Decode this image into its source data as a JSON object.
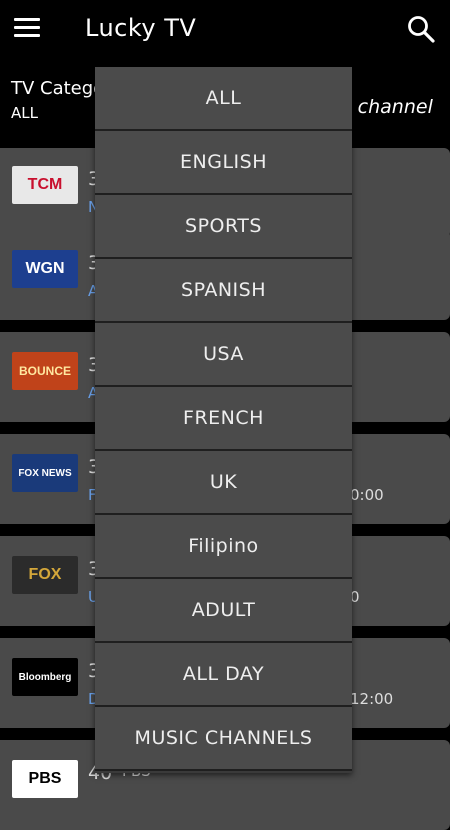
{
  "app": {
    "title": "Lucky TV"
  },
  "header": {
    "category_label": "TV Catego",
    "category_value": "ALL",
    "right_text": "o channel"
  },
  "icons": {
    "menu": "hamburger-menu-icon",
    "search": "search-icon"
  },
  "dropdown": {
    "options": [
      "ALL",
      "ENGLISH",
      "SPORTS",
      "SPANISH",
      "USA",
      "FRENCH",
      "UK",
      "Filipino",
      "ADULT",
      "ALL DAY",
      "MUSIC CHANNELS"
    ]
  },
  "channels": [
    {
      "logo_text": "TCM",
      "logo_bg": "#e8e8e8",
      "logo_fg": "#c8102e",
      "number": "3",
      "sub": "N",
      "time": ""
    },
    {
      "logo_text": "WGN",
      "logo_bg": "#1d3f8f",
      "logo_fg": "#ffffff",
      "number": "3",
      "sub": "A",
      "time": ""
    },
    {
      "logo_text": "BOUNCE",
      "logo_bg": "#c0431a",
      "logo_fg": "#ffe8a0",
      "number": "3",
      "sub": "A",
      "time": ""
    },
    {
      "logo_text": "FOX NEWS",
      "logo_bg": "#1a3a7a",
      "logo_fg": "#ffffff",
      "number": "3",
      "sub": "F",
      "time": "0:00"
    },
    {
      "logo_text": "FOX",
      "logo_bg": "#2b2b2b",
      "logo_fg": "#d4a73a",
      "number": "3",
      "sub": "U",
      "time": "0"
    },
    {
      "logo_text": "Bloomberg",
      "logo_bg": "#000000",
      "logo_fg": "#ffffff",
      "number": "3",
      "sub": "D",
      "time": "12:00"
    },
    {
      "logo_text": "PBS",
      "logo_bg": "#ffffff",
      "logo_fg": "#000000",
      "number": "40",
      "sub": "PBS",
      "time": ""
    }
  ]
}
